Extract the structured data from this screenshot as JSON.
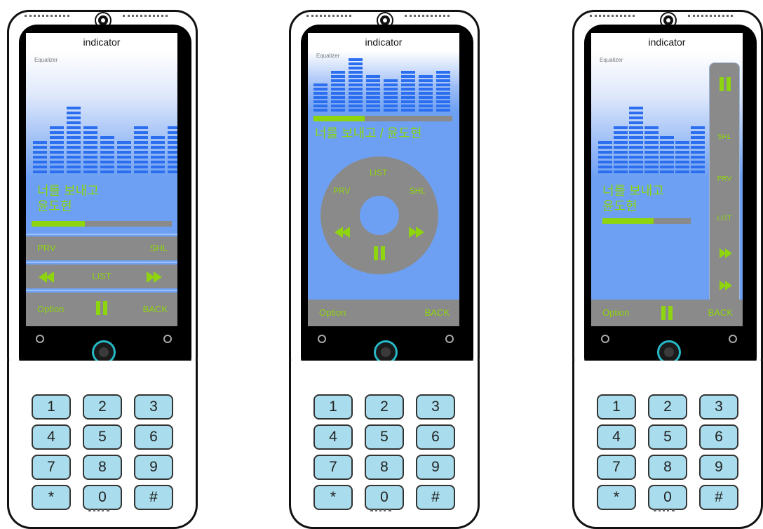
{
  "phones": [
    {
      "indicator": "indicator",
      "equalizer_label": "Equalizer",
      "song_title_line1": "너를 보내고",
      "song_title_line2": "윤도현",
      "progress": 0.38,
      "row1_left": "PRV",
      "row1_right": "SHL",
      "row2_center": "LIST",
      "row3_left": "Option",
      "row3_right": "BACK"
    },
    {
      "indicator": "indicator",
      "equalizer_label": "Equalizer",
      "song_title": "너를 보내고 / 윤도현",
      "progress": 0.37,
      "wheel_top": "LIST",
      "wheel_left": "PRV",
      "wheel_right": "SHL",
      "bottom_left": "Option",
      "bottom_right": "BACK"
    },
    {
      "indicator": "indicator",
      "equalizer_label": "Equalizer",
      "song_title_line1": "너를 보내고",
      "song_title_line2": "윤도현",
      "progress": 0.58,
      "side_items": [
        "SHL",
        "PRV",
        "LIST"
      ],
      "bottom_left": "Option",
      "bottom_right": "BACK"
    }
  ],
  "keypad": [
    "1",
    "2",
    "3",
    "4",
    "5",
    "6",
    "7",
    "8",
    "9",
    "*",
    "0",
    "#"
  ],
  "colors": {
    "accent": "#8ed40f",
    "screen": "#6da0f3",
    "bars": "#2b6ff0",
    "control": "#8a8a8a",
    "key": "#a9dcec"
  }
}
